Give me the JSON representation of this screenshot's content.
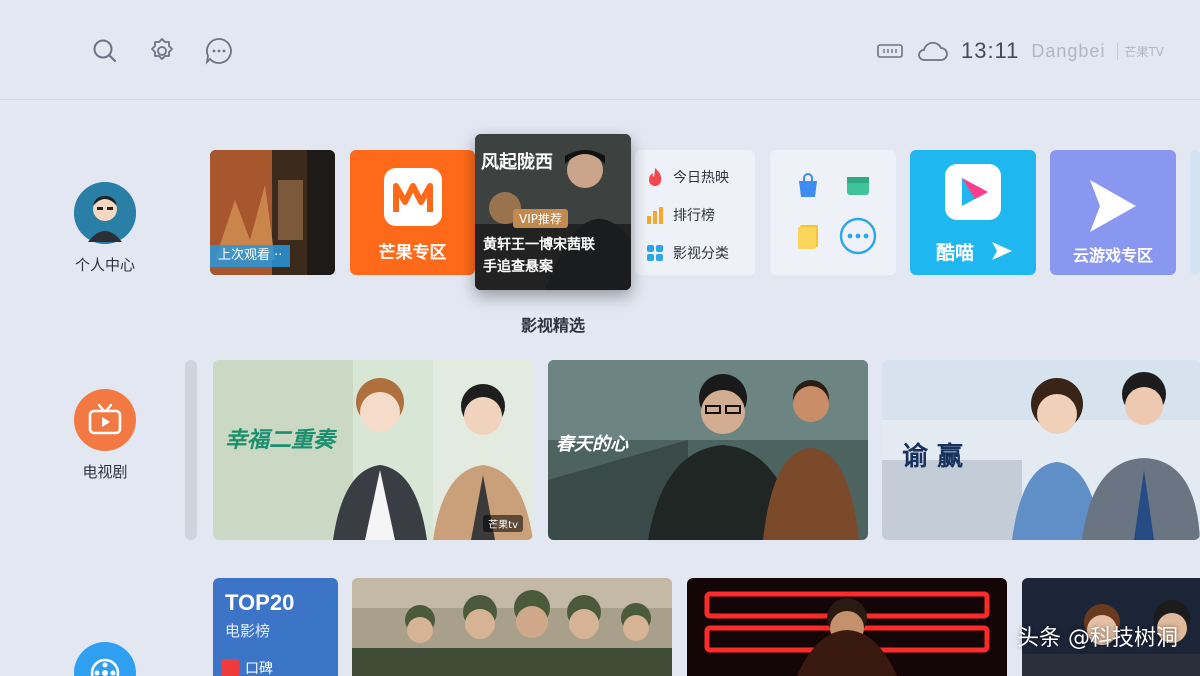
{
  "topbar": {
    "icons": [
      "search-icon",
      "gear-icon",
      "message-icon"
    ],
    "time": "13:11",
    "brand": "Dangbei",
    "brand_sub": "芒果TV"
  },
  "sidebar": {
    "items": [
      {
        "label": "个人中心",
        "icon": "avatar"
      },
      {
        "label": "电视剧",
        "icon": "tv-icon"
      },
      {
        "label": "",
        "icon": "film-icon"
      }
    ]
  },
  "row1": {
    "recent_label": "上次观看",
    "mango_label": "芒果专区",
    "featured": {
      "title_art": "风起陇西",
      "badge": "VIP推荐",
      "line1": "黄轩王一博宋茜联",
      "line2": "手追查悬案",
      "caption": "影视精选"
    },
    "quick_links": [
      {
        "label": "今日热映",
        "icon": "flame-icon"
      },
      {
        "label": "排行榜",
        "icon": "bar-chart-icon"
      },
      {
        "label": "影视分类",
        "icon": "grid-icon"
      }
    ],
    "kumiao_label": "酷喵",
    "game_label": "云游戏专区",
    "colors": {
      "mango": "#ff6a1a",
      "kumiao": "#1fb7f0",
      "game": "#8a97f0"
    }
  },
  "row2": {
    "cards": [
      {
        "title": "幸福二重奏",
        "badge": "芒果tv"
      },
      {
        "title": "春天的心"
      },
      {
        "title": "谕 赢"
      }
    ]
  },
  "row3": {
    "top20": {
      "title": "TOP20",
      "subtitle": "电影榜",
      "tag": "口碑"
    }
  },
  "watermark": "头条 @科技树洞"
}
